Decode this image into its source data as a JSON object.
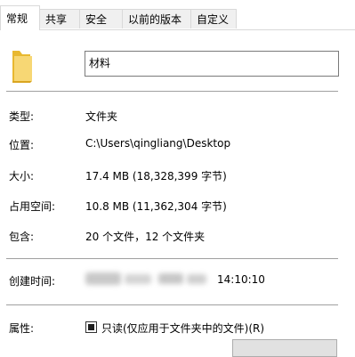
{
  "tabs": [
    {
      "label": "常规"
    },
    {
      "label": "共享"
    },
    {
      "label": "安全"
    },
    {
      "label": "以前的版本"
    },
    {
      "label": "自定义"
    }
  ],
  "name": {
    "value": "材料"
  },
  "rows": {
    "type": {
      "label": "类型:",
      "value": "文件夹"
    },
    "location": {
      "label": "位置:",
      "value": "C:\\Users\\qingliang\\Desktop"
    },
    "size": {
      "label": "大小:",
      "value": "17.4 MB (18,328,399 字节)"
    },
    "size_on_disk": {
      "label": "占用空间:",
      "value": "10.8 MB (11,362,304 字节)"
    },
    "contains": {
      "label": "包含:",
      "value": "20 个文件，12 个文件夹"
    },
    "created": {
      "label": "创建时间:",
      "value": "14:10:10"
    }
  },
  "attributes": {
    "label": "属性:",
    "readonly_label": "只读(仅应用于文件夹中的文件)(R)",
    "readonly_state": "indeterminate"
  },
  "icons": {
    "folder": "folder-icon",
    "checkbox": "checkbox-indeterminate"
  },
  "colors": {
    "folder": "#f2c94c",
    "border": "#d9d9d9",
    "separator": "#a0a0a0"
  }
}
